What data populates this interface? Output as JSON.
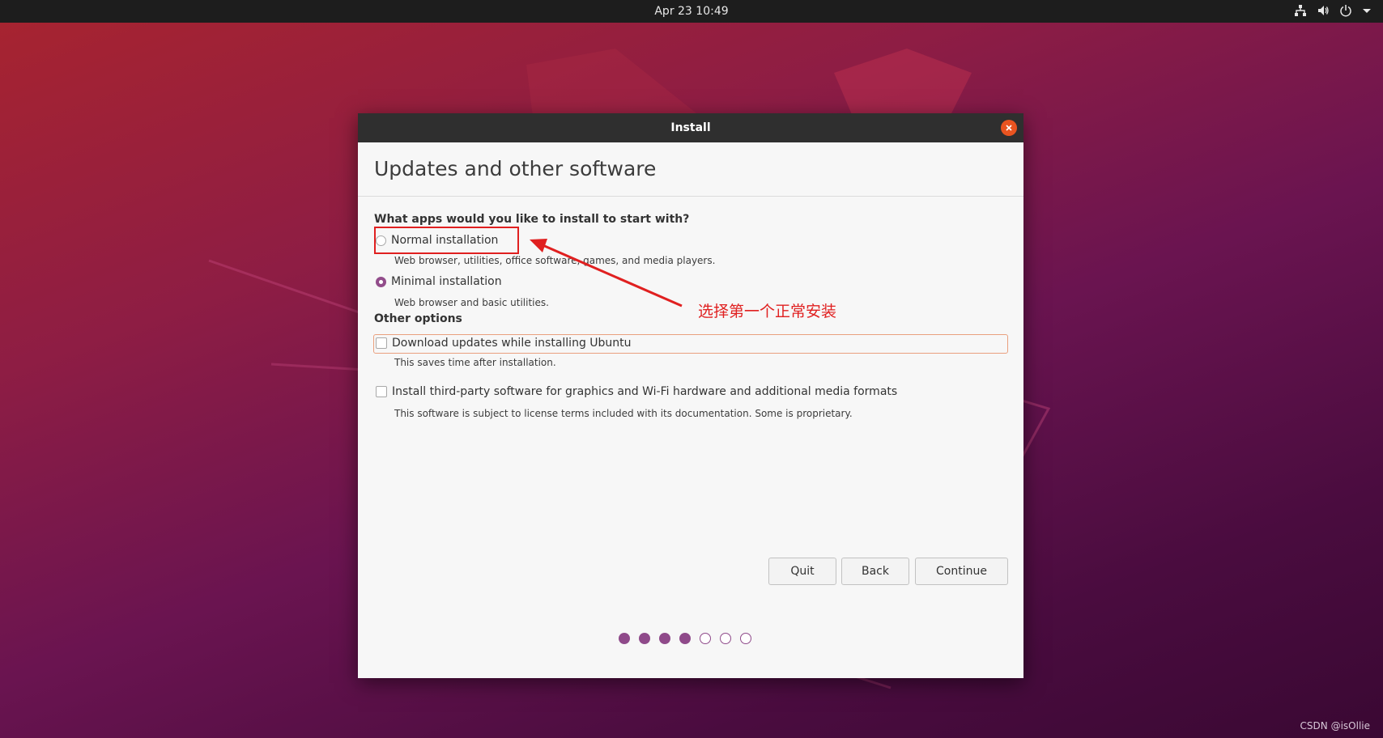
{
  "topbar": {
    "datetime": "Apr 23  10:49",
    "tray_icons": [
      "network-icon",
      "volume-icon",
      "power-icon",
      "chevron-down-icon"
    ]
  },
  "window": {
    "title": "Install",
    "page_title": "Updates and other software",
    "question": "What apps would you like to install to start with?",
    "options": {
      "normal": {
        "label": "Normal installation",
        "desc": "Web browser, utilities, office software, games, and media players.",
        "selected": false
      },
      "minimal": {
        "label": "Minimal installation",
        "desc": "Web browser and basic utilities.",
        "selected": true
      }
    },
    "other_heading": "Other options",
    "checks": {
      "updates": {
        "label": "Download updates while installing Ubuntu",
        "desc": "This saves time after installation.",
        "checked": false
      },
      "thirdparty": {
        "label": "Install third-party software for graphics and Wi-Fi hardware and additional media formats",
        "desc": "This software is subject to license terms included with its documentation. Some is proprietary.",
        "checked": false
      }
    },
    "buttons": {
      "quit": "Quit",
      "back": "Back",
      "continue": "Continue"
    },
    "progress": {
      "total_steps": 7,
      "completed_steps": 4
    }
  },
  "annotation": {
    "text": "选择第一个正常安装",
    "color": "#e02020"
  },
  "watermark": "CSDN @isOllie",
  "colors": {
    "accent_purple": "#924d8b",
    "close_orange": "#e95420",
    "titlebar": "#2f2f2f"
  }
}
